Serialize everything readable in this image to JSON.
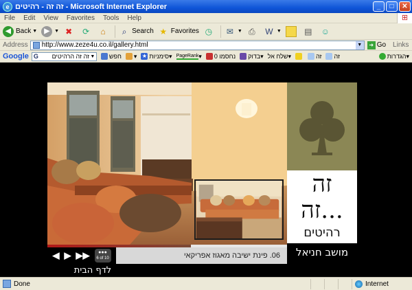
{
  "window": {
    "title": "זה זה - רהיטים - Microsoft Internet Explorer"
  },
  "menu": [
    "File",
    "Edit",
    "View",
    "Favorites",
    "Tools",
    "Help"
  ],
  "toolbar": {
    "back": "Back",
    "search": "Search",
    "favorites": "Favorites"
  },
  "address": {
    "label": "Address",
    "url": "http://www.zeze4u.co.il/gallery.html",
    "go": "Go",
    "links": "Links"
  },
  "googlebar": {
    "logo": "Google",
    "search_value": "זה זה הרהיטים",
    "search_btn": "חפש",
    "bookmarks": "סימניות",
    "pagerank": "PageRank",
    "blocked": "נחסמו 0",
    "check": "בדוק",
    "send": "שלח אל",
    "word1": "זה",
    "word2": "זה",
    "settings": "הגדרות"
  },
  "gallery": {
    "counter": "6 of 10",
    "caption": "06.  פינת ישיבה מאגוז אפריקאי",
    "back_home": "לדף הבית",
    "progress": 0.6
  },
  "brand": {
    "line1": "זה",
    "line2": "זה...",
    "subtitle": "רהיטים",
    "location": "מושב חניאל"
  },
  "status": {
    "text": "Done",
    "zone": "Internet"
  }
}
